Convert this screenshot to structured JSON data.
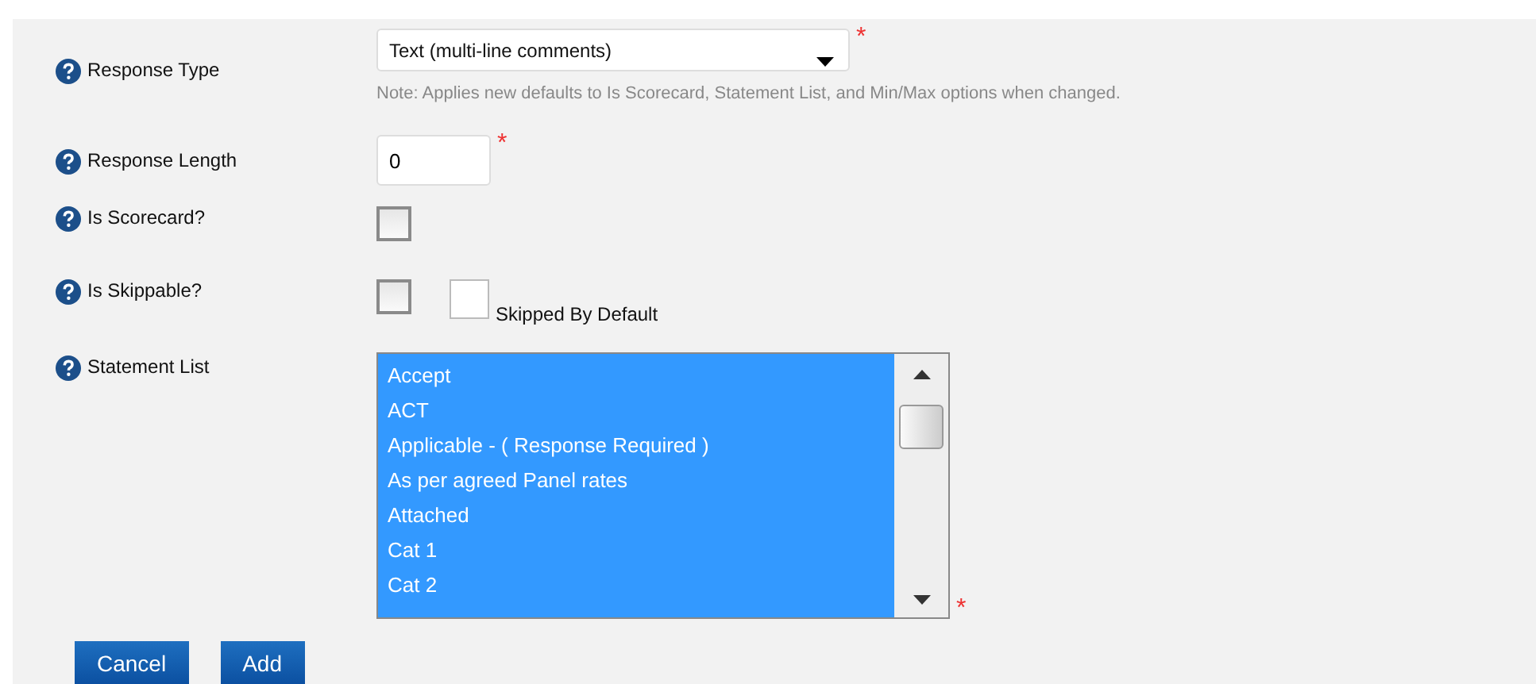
{
  "fields": [
    {
      "kind": "select",
      "label": "Response Type",
      "value": "Text (multi-line comments)",
      "required_mark": "*",
      "note": "Note: Applies new defaults to Is Scorecard, Statement List, and Min/Max options when changed."
    },
    {
      "kind": "text",
      "label": "Response Length",
      "value": "0",
      "required_mark": "*"
    },
    {
      "kind": "checkbox",
      "label": "Is Scorecard?",
      "checked": false
    },
    {
      "kind": "checkbox",
      "label": "Is Skippable?",
      "checked": false,
      "extra": {
        "label": "Skipped By Default",
        "checked": false
      }
    },
    {
      "kind": "listbox",
      "label": "Statement List",
      "required_mark": "*",
      "options": [
        {
          "label": "Accept",
          "selected": true
        },
        {
          "label": "ACT",
          "selected": true
        },
        {
          "label": "Applicable - ( Response Required )",
          "selected": true
        },
        {
          "label": "As per agreed Panel rates",
          "selected": true
        },
        {
          "label": "Attached",
          "selected": true
        },
        {
          "label": "Cat 1",
          "selected": true
        },
        {
          "label": "Cat 2",
          "selected": true
        }
      ]
    }
  ],
  "buttons": [
    "Cancel",
    "Add"
  ]
}
